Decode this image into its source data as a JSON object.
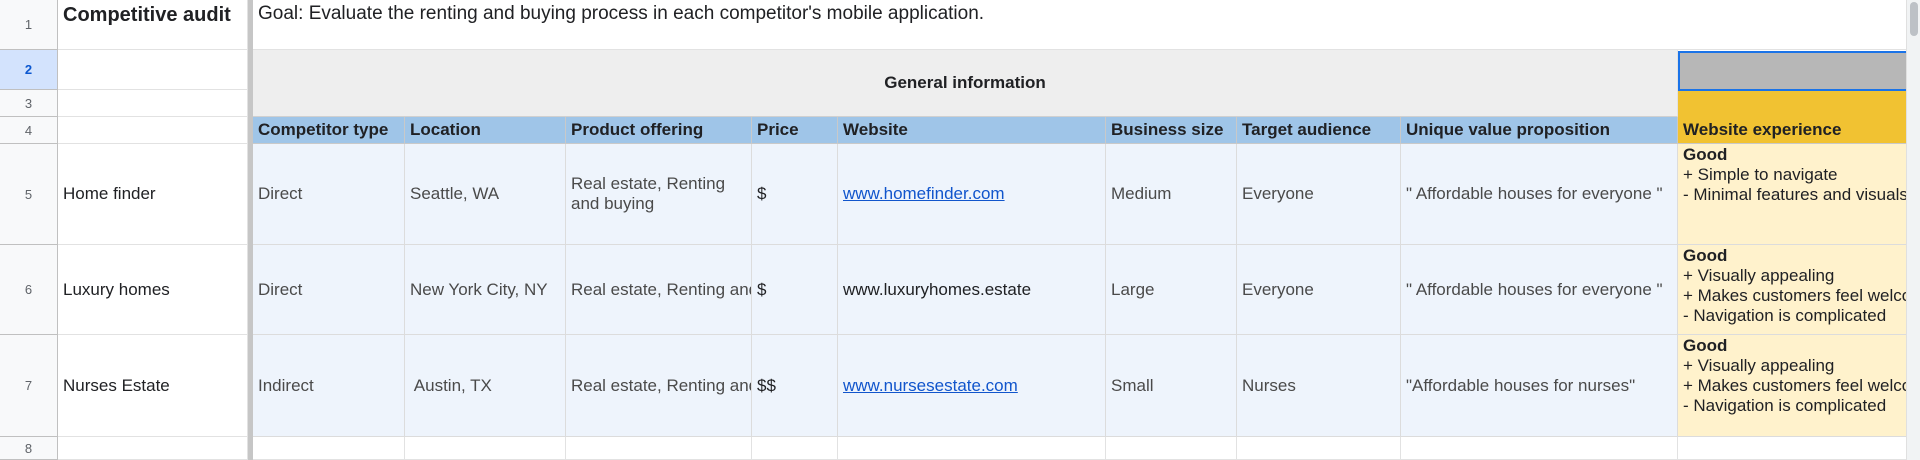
{
  "sheet": {
    "row_numbers": [
      "1",
      "2",
      "3",
      "4",
      "5",
      "6",
      "7",
      "8"
    ],
    "title": "Competitive audit",
    "goal": "Goal: Evaluate the renting and buying process in each competitor's mobile application.",
    "section_header": "General information",
    "columns": [
      "Competitor type",
      "Location",
      "Product offering",
      "Price",
      "Website",
      "Business size",
      "Target audience",
      "Unique value proposition",
      "Website experience"
    ],
    "rows": [
      {
        "name": "Home finder",
        "type": "Direct",
        "location": "Seattle, WA",
        "offering": "Real estate, Renting and buying",
        "price": "$",
        "website": "www.homefinder.com",
        "size": "Medium",
        "audience": "Everyone",
        "uvp": "\" Affordable houses for everyone \"",
        "experience": [
          "Good",
          "+ Simple to navigate",
          "- Minimal features and visuals"
        ]
      },
      {
        "name": "Luxury homes",
        "type": "Direct",
        "location": "New York City, NY",
        "offering": "Real estate, Renting and buying",
        "price": "$",
        "website": "www.luxuryhomes.estate",
        "size": "Large",
        "audience": "Everyone",
        "uvp": "\" Affordable houses for everyone \"",
        "experience": [
          "Good",
          "+ Visually appealing",
          "+ Makes customers feel welcome",
          "- Navigation is complicated"
        ]
      },
      {
        "name": "Nurses Estate",
        "type": "Indirect",
        "location": " Austin, TX",
        "offering": "Real estate, Renting and buying",
        "price": "$$",
        "website": "www.nursesestate.com",
        "size": "Small",
        "audience": "Nurses",
        "uvp": "\"Affordable houses for nurses\"",
        "experience": [
          "Good",
          "+ Visually appealing",
          "+ Makes customers feel welcome",
          "- Navigation is complicated"
        ]
      }
    ]
  },
  "colors": {
    "header_blue": "#9fc5e8",
    "header_gold": "#f1c232",
    "body_blue": "#eef4fc",
    "body_gold": "#fff2cc",
    "section_gray": "#eeeeee",
    "selected_cell": "#b7b7b7",
    "link": "#1155cc"
  }
}
